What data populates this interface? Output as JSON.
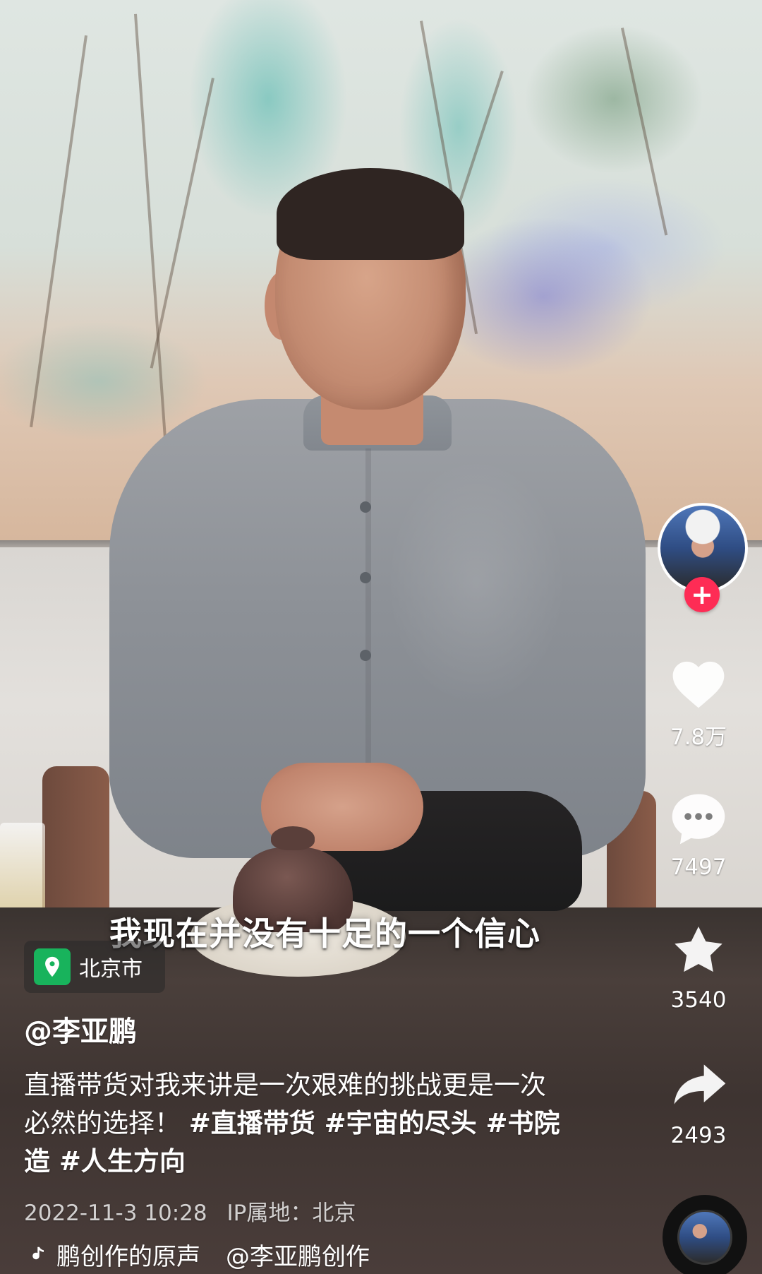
{
  "video": {
    "caption_text": "我现在并没有十足的一个信心"
  },
  "location": {
    "label": "北京市",
    "icon": "location-pin-icon",
    "accent_color": "#18b35c"
  },
  "post": {
    "author": "@李亚鹏",
    "description_main": "直播带货对我来讲是一次艰难的挑战更是一次必然的选择！",
    "hashtags": "#直播带货 #宇宙的尽头 #书院造 #人生方向",
    "date_time": "2022-11-3 10:28",
    "ip_location": "IP属地：北京"
  },
  "music": {
    "icon": "music-note-icon",
    "title_fragment": "鹏创作的原声",
    "artist_fragment": "@李亚鹏创作"
  },
  "actions": {
    "follow_icon": "plus-icon",
    "like_count": "7.8万",
    "comment_count": "7497",
    "favorite_count": "3540",
    "share_count": "2493"
  },
  "colors": {
    "follow": "#fe2c55",
    "text": "#ffffff"
  }
}
